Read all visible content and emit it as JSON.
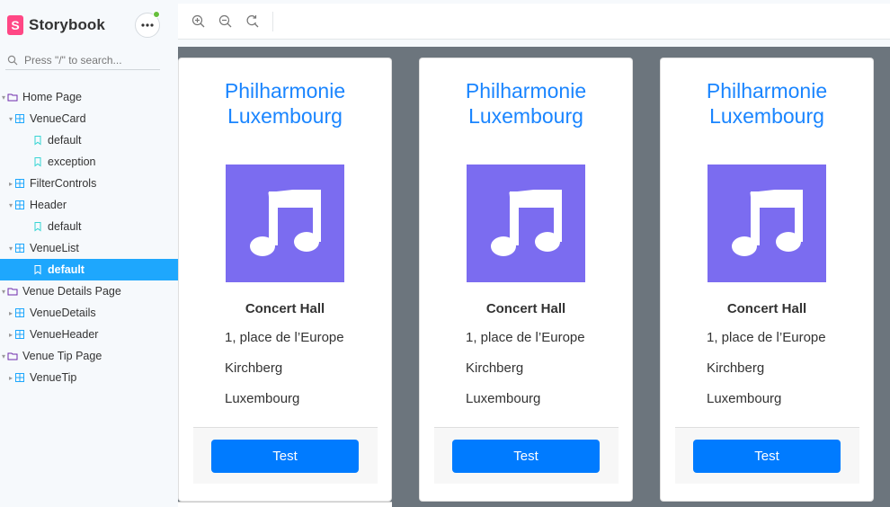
{
  "app": {
    "title": "Storybook",
    "logo_letter": "S",
    "menu_icon": "more-horizontal-icon",
    "status_color": "#66bf3c"
  },
  "search": {
    "placeholder": "Press \"/\" to search..."
  },
  "sidebar": {
    "items": [
      {
        "label": "Home Page",
        "type": "group",
        "level": 0,
        "expanded": true
      },
      {
        "label": "VenueCard",
        "type": "component",
        "level": 1,
        "expanded": true
      },
      {
        "label": "default",
        "type": "story",
        "level": 2
      },
      {
        "label": "exception",
        "type": "story",
        "level": 2
      },
      {
        "label": "FilterControls",
        "type": "component",
        "level": 1,
        "expanded": false
      },
      {
        "label": "Header",
        "type": "component",
        "level": 1,
        "expanded": true
      },
      {
        "label": "default",
        "type": "story",
        "level": 2
      },
      {
        "label": "VenueList",
        "type": "component",
        "level": 1,
        "expanded": true
      },
      {
        "label": "default",
        "type": "story",
        "level": 2,
        "selected": true
      },
      {
        "label": "Venue Details Page",
        "type": "group",
        "level": 0,
        "expanded": true
      },
      {
        "label": "VenueDetails",
        "type": "component",
        "level": 1,
        "expanded": false
      },
      {
        "label": "VenueHeader",
        "type": "component",
        "level": 1,
        "expanded": false
      },
      {
        "label": "Venue Tip Page",
        "type": "group",
        "level": 0,
        "expanded": true
      },
      {
        "label": "VenueTip",
        "type": "component",
        "level": 1,
        "expanded": false
      }
    ],
    "selected_color": "#1ea7fd"
  },
  "toolbar": {
    "tools": [
      "zoom-in-icon",
      "zoom-out-icon",
      "zoom-reset-icon"
    ]
  },
  "cards": [
    {
      "title": "Philharmonie Luxembourg",
      "type": "Concert Hall",
      "address": "1, place de l’Europe",
      "district": "Kirchberg",
      "city": "Luxembourg",
      "button": "Test",
      "image_icon": "music-note-icon"
    },
    {
      "title": "Philharmonie Luxembourg",
      "type": "Concert Hall",
      "address": "1, place de l’Europe",
      "district": "Kirchberg",
      "city": "Luxembourg",
      "button": "Test",
      "image_icon": "music-note-icon"
    },
    {
      "title": "Philharmonie Luxembourg",
      "type": "Concert Hall",
      "address": "1, place de l’Europe",
      "district": "Kirchberg",
      "city": "Luxembourg",
      "button": "Test",
      "image_icon": "music-note-icon"
    }
  ],
  "colors": {
    "brand": "#ff4785",
    "title_blue": "#1a85ff",
    "button_blue": "#007bff",
    "image_bg": "#7b6cf0",
    "preview_bg": "#6c757d"
  }
}
